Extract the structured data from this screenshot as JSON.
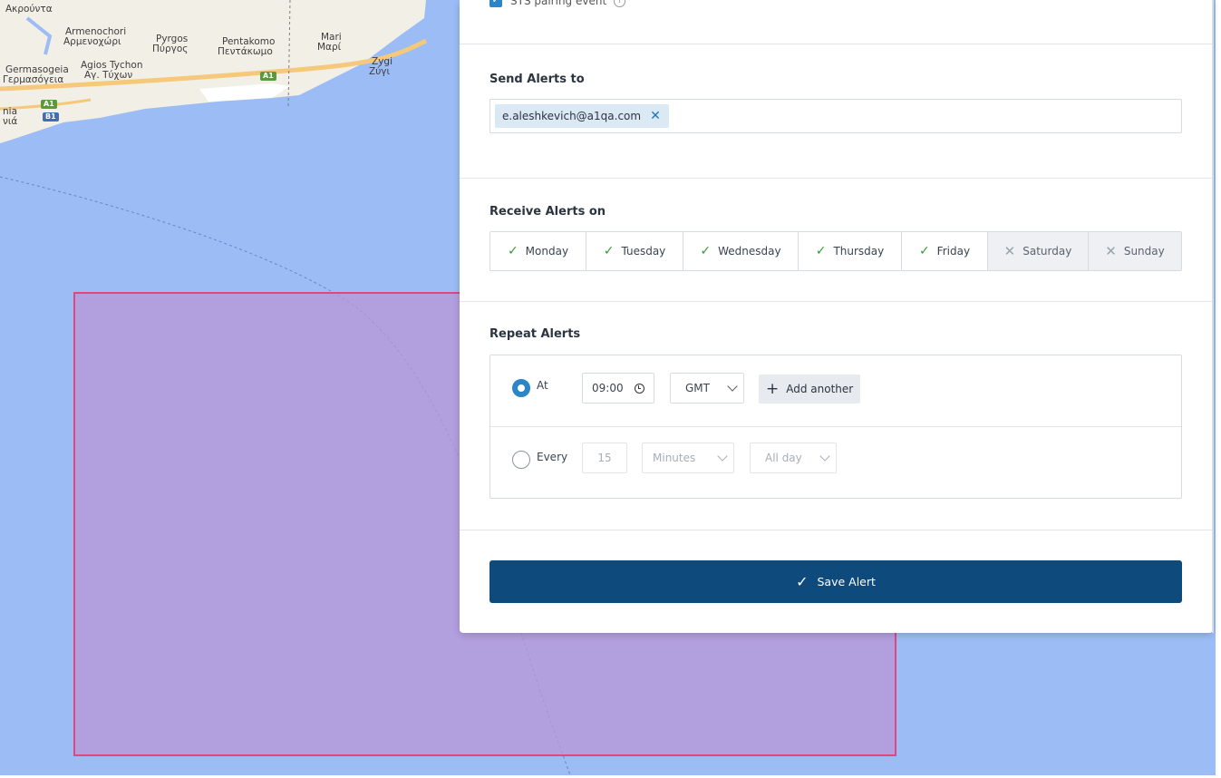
{
  "map": {
    "labels": [
      {
        "text": "Ακρούντα"
      },
      {
        "text": "Armenochori"
      },
      {
        "text": "Αρμενοχώρι"
      },
      {
        "text": "Pyrgos"
      },
      {
        "text": "Πύργος"
      },
      {
        "text": "Pentakomo"
      },
      {
        "text": "Πεντάκωμο"
      },
      {
        "text": "Mari"
      },
      {
        "text": "Μαρί"
      },
      {
        "text": "Germasogeia"
      },
      {
        "text": "Γερμασόγεια"
      },
      {
        "text": "Agios Tychon"
      },
      {
        "text": "Αγ. Τύχων"
      },
      {
        "text": "Zygi"
      },
      {
        "text": "Ζύγι"
      },
      {
        "text": "nia"
      },
      {
        "text": "νιά"
      }
    ],
    "shields": [
      {
        "text": "A1",
        "color": "green"
      },
      {
        "text": "A1",
        "color": "green"
      },
      {
        "text": "B1",
        "color": "blue"
      }
    ],
    "colors": {
      "sea": "#9bbcf4",
      "land": "#f2efe6",
      "region_fill": "#b996d7",
      "region_border": "#e5457f"
    }
  },
  "panel": {
    "top_option": {
      "label": "STS pairing event",
      "checked": true
    },
    "send_alerts": {
      "title": "Send Alerts to",
      "recipients": [
        "e.aleshkevich@a1qa.com"
      ]
    },
    "receive_alerts": {
      "title": "Receive Alerts on",
      "days": [
        {
          "label": "Monday",
          "on": true
        },
        {
          "label": "Tuesday",
          "on": true
        },
        {
          "label": "Wednesday",
          "on": true
        },
        {
          "label": "Thursday",
          "on": true
        },
        {
          "label": "Friday",
          "on": true
        },
        {
          "label": "Saturday",
          "on": false
        },
        {
          "label": "Sunday",
          "on": false
        }
      ]
    },
    "repeat_alerts": {
      "title": "Repeat Alerts",
      "at": {
        "label": "At",
        "selected": true,
        "time": "09:00",
        "timezone": "GMT",
        "add_label": "Add another"
      },
      "every": {
        "label": "Every",
        "selected": false,
        "value": "15",
        "unit": "Minutes",
        "period": "All day"
      }
    },
    "save_label": "Save Alert",
    "accent": "#2a86c9",
    "save_color": "#0f4a7c"
  }
}
